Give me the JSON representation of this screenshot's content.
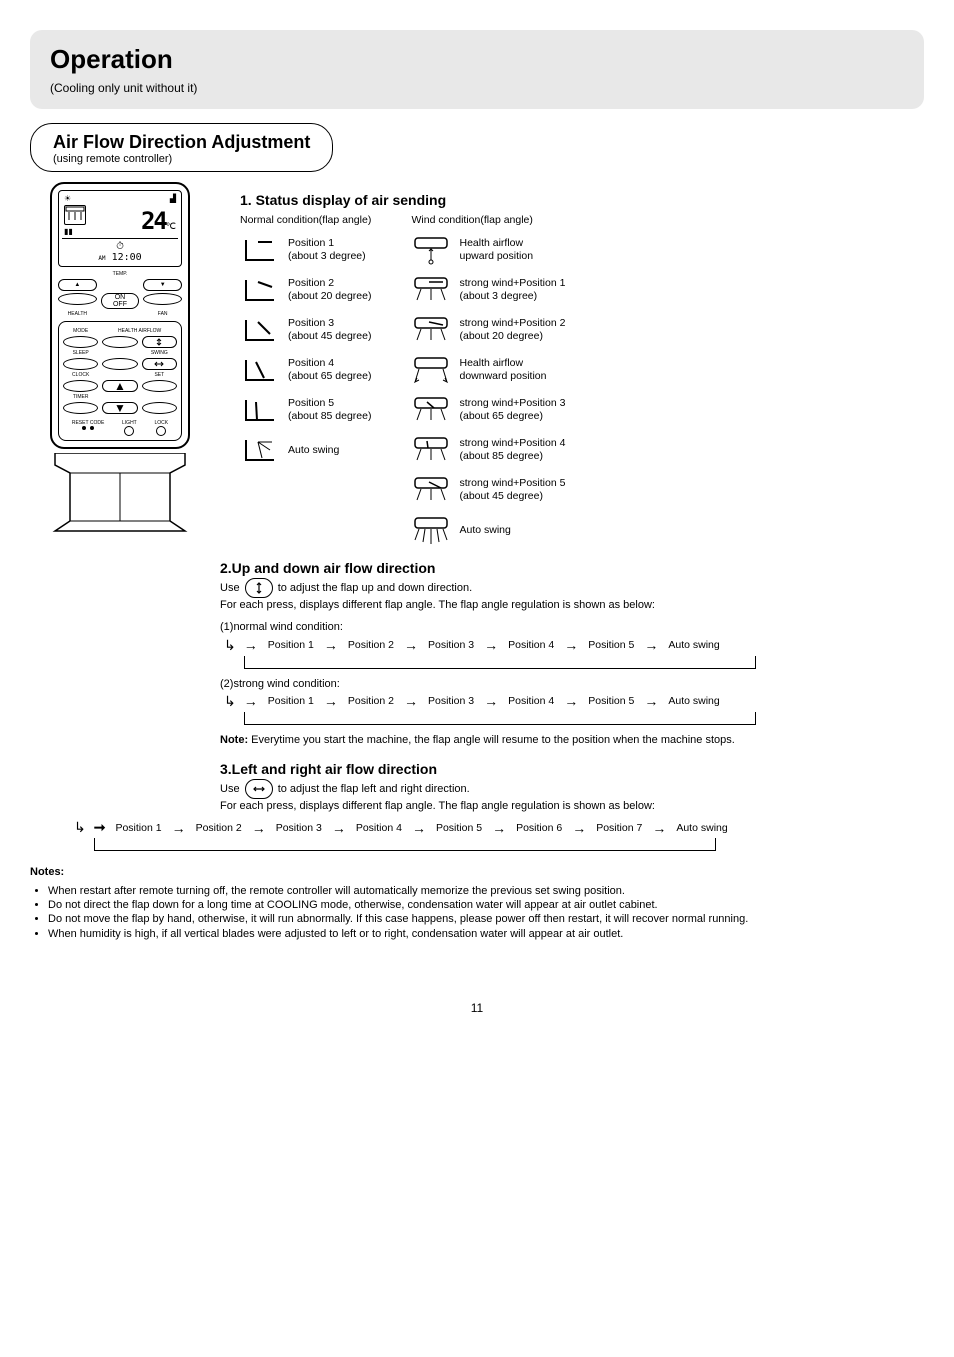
{
  "header": {
    "title": "Operation",
    "subtitle": "(Cooling only unit without it)"
  },
  "airflow": {
    "title": "Air Flow Direction Adjustment",
    "sub": "(using remote controller)"
  },
  "remote": {
    "lcd": {
      "temp": "24",
      "temp_unit": "℃",
      "clock_prefix": "AM",
      "clock": "12:00"
    },
    "row1": {
      "l": "HEALTH",
      "c": "TEMP.",
      "r": "FAN"
    },
    "onoff": "ON\nOFF",
    "panel": {
      "r1l": "MODE",
      "r1c": "HEALTH AIRFLOW",
      "r2l": "SLEEP",
      "r2r": "SWING",
      "r3l": "CLOCK",
      "r3r": "SET",
      "r4l": "TIMER",
      "bottom_l": "RESET CODE",
      "bottom_c": "LIGHT",
      "bottom_r": "LOCK"
    }
  },
  "status": {
    "heading": "1. Status display of air sending",
    "cola_title": "Normal condition(flap angle)",
    "colb_title": "Wind condition(flap angle)",
    "a": [
      "Position 1\n(about 3 degree)",
      "Position 2\n(about 20 degree)",
      "Position 3\n(about 45 degree)",
      "Position 4\n(about 65 degree)",
      "Position 5\n(about 85 degree)",
      "Auto swing"
    ],
    "b": [
      "Health airflow\nupward position",
      "strong wind+Position 1\n(about 3 degree)",
      "strong wind+Position 2\n(about 20 degree)",
      "Health airflow\ndownward position",
      "strong wind+Position 3\n(about 65 degree)",
      "strong wind+Position 4\n(about 85 degree)",
      "strong wind+Position 5\n(about 45 degree)",
      "Auto swing"
    ]
  },
  "updown": {
    "heading": "2.Up and down air flow direction",
    "body1_a": "Use ",
    "body1_b": " to adjust the flap up and down direction.",
    "body2": "For each press, displays different flap angle. The flap angle regulation is shown as below:",
    "group1": "(1)normal wind condition:",
    "flow1": [
      "Position 1",
      "Position 2",
      "Position 3",
      "Position 4",
      "Position 5",
      "Auto swing"
    ],
    "group2": "(2)strong wind condition:",
    "flow2": [
      "Position 1",
      "Position 2",
      "Position 3",
      "Position 4",
      "Position 5",
      "Auto swing"
    ],
    "note_label": "Note:",
    "note": "Everytime you start the machine, the flap angle will resume to the position when the machine stops."
  },
  "leftright": {
    "heading": "3.Left and right air flow direction",
    "body1_a": "Use ",
    "body1_b": " to adjust the flap left and right direction.",
    "body2": "For each press, displays different flap angle. The flap angle regulation is shown as below:",
    "flow": [
      "Position 1",
      "Position 2",
      "Position 3",
      "Position 4",
      "Position 5",
      "Position 6",
      "Position 7",
      "Auto swing"
    ],
    "notes_label": "Notes:",
    "notes": [
      "When restart after remote turning off, the remote controller will automatically memorize the previous set swing position.",
      "Do not direct the flap down for a long time at COOLING mode, otherwise, condensation water will appear at air outlet cabinet.",
      "Do not move the flap by hand, otherwise, it will run abnormally. If this case happens, please power off then restart, it will recover normal running.",
      "When humidity is high, if all vertical blades were adjusted to left or to right, condensation water will appear at air outlet."
    ]
  },
  "page": "11"
}
